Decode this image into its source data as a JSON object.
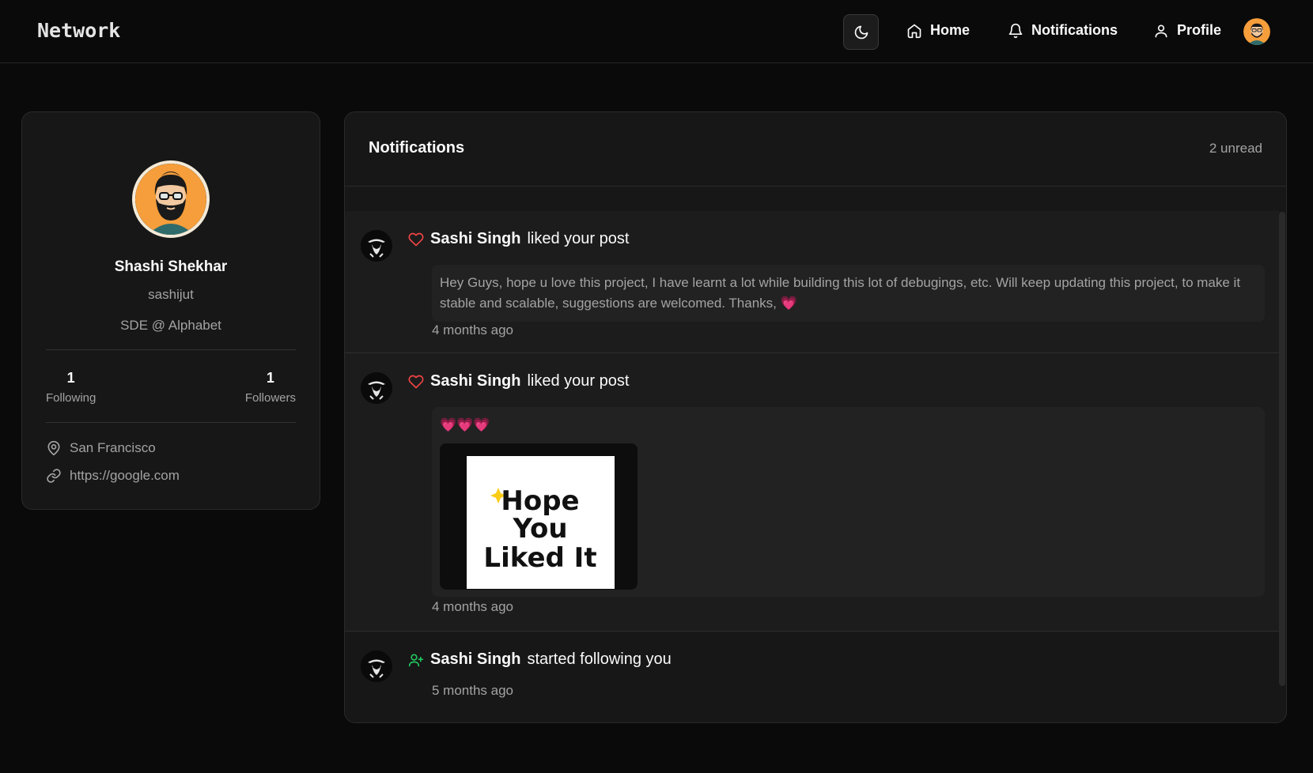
{
  "header": {
    "brand": "Network",
    "nav": [
      {
        "label": "Home",
        "icon": "home-icon"
      },
      {
        "label": "Notifications",
        "icon": "bell-icon"
      },
      {
        "label": "Profile",
        "icon": "user-icon"
      }
    ],
    "theme_icon": "moon-icon"
  },
  "profile": {
    "name": "Shashi Shekhar",
    "username": "sashijut",
    "bio": "SDE @ Alphabet",
    "following_count": "1",
    "following_label": "Following",
    "followers_count": "1",
    "followers_label": "Followers",
    "location": "San Francisco",
    "website": "https://google.com"
  },
  "notifications": {
    "title": "Notifications",
    "unread": "2 unread",
    "items": [
      {
        "type": "like",
        "user": "Sashi Singh",
        "action": "liked your post",
        "preview": "Hey Guys, hope u love this project, I have learnt a lot while building this lot of debugings, etc. Will keep updating this project, to make it stable and scalable, suggestions are welcomed. Thanks, 💗",
        "time": "4 months ago"
      },
      {
        "type": "like",
        "user": "Sashi Singh",
        "action": "liked your post",
        "preview": "💗💗💗",
        "image_text": [
          "Hope",
          "You",
          "Liked It"
        ],
        "time": "4 months ago"
      },
      {
        "type": "follow",
        "user": "Sashi Singh",
        "action": "started following you",
        "time": "5 months ago"
      }
    ]
  },
  "colors": {
    "background": "#0a0a0a",
    "card": "#171717",
    "like": "#ef4444",
    "follow": "#22c55e"
  }
}
